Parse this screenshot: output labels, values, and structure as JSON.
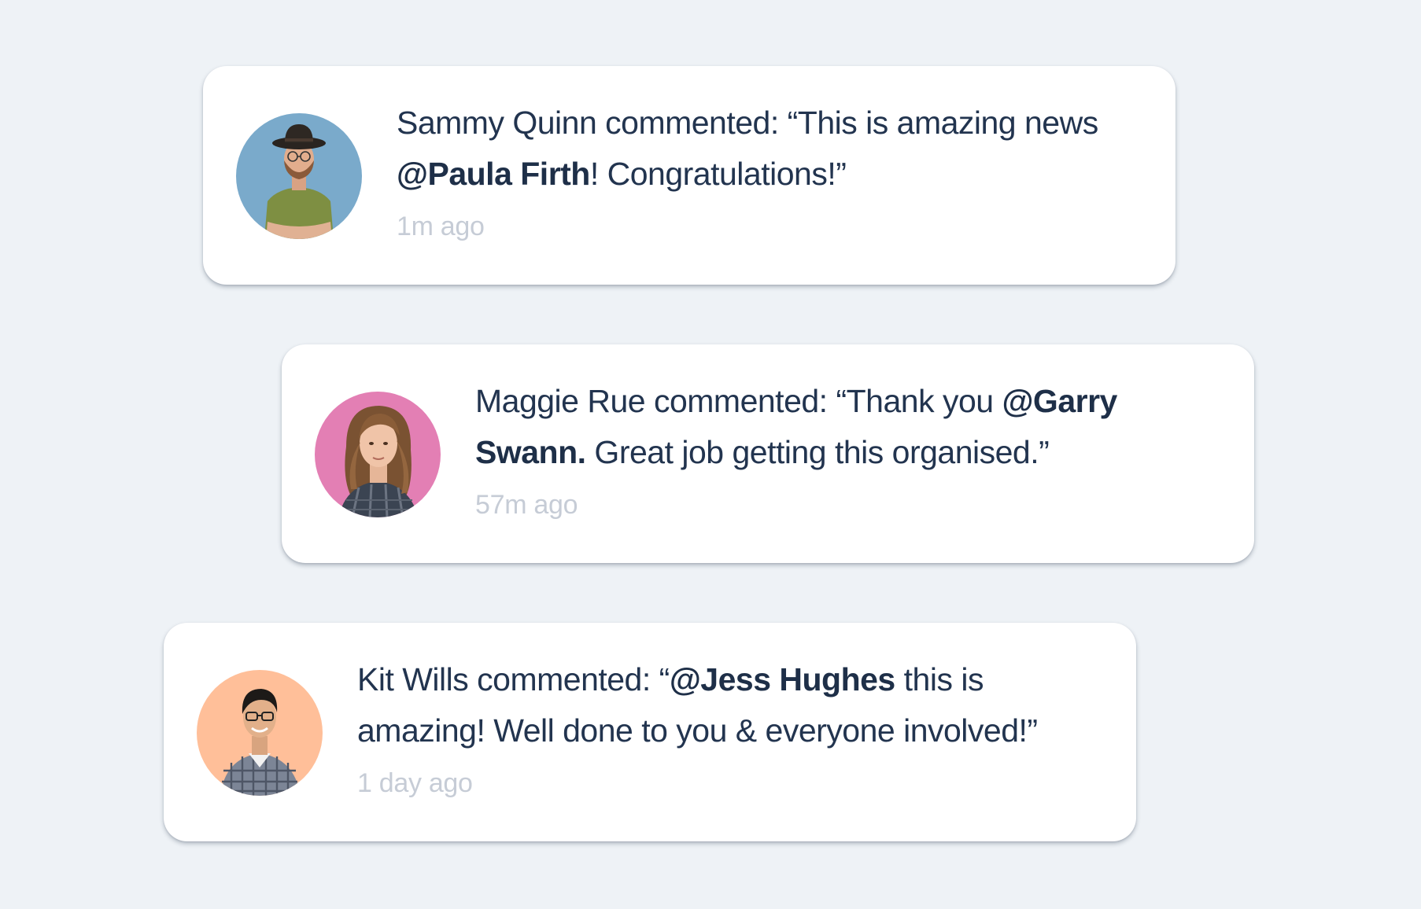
{
  "notifications": [
    {
      "avatar_icon": "person-with-hat-avatar",
      "avatar_bg": "#7aaacb",
      "prefix": "Sammy Quinn commented: “This is amazing news ",
      "mention": "@Paula Firth",
      "suffix": "! Congratulations!”",
      "time": "1m ago"
    },
    {
      "avatar_icon": "woman-avatar",
      "avatar_bg": "#e37fb4",
      "prefix": "Maggie Rue commented: “Thank you ",
      "mention": "@Garry Swann.",
      "suffix": " Great job getting this organised.”",
      "time": "57m ago"
    },
    {
      "avatar_icon": "man-with-glasses-avatar",
      "avatar_bg": "#ffbf99",
      "prefix": "Kit Wills commented: “",
      "mention": "@Jess Hughes",
      "suffix": " this is amazing! Well done to you & everyone involved!”",
      "time": "1 day ago"
    }
  ],
  "colors": {
    "page_background": "#eef2f6",
    "card_background": "#ffffff",
    "text": "#22344f",
    "muted_text": "#c6ccd6"
  }
}
